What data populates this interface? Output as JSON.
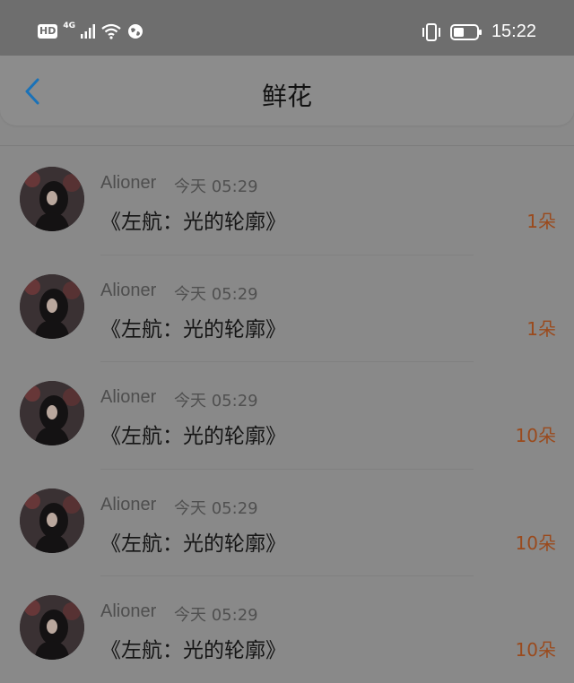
{
  "status_bar": {
    "hd_label": "HD",
    "network_label": "4G",
    "time": "15:22"
  },
  "header": {
    "title": "鲜花"
  },
  "items": [
    {
      "username": "Alioner",
      "time": "今天 05:29",
      "title": "《左航：光的轮廓》",
      "count": "1朵"
    },
    {
      "username": "Alioner",
      "time": "今天 05:29",
      "title": "《左航：光的轮廓》",
      "count": "1朵"
    },
    {
      "username": "Alioner",
      "time": "今天 05:29",
      "title": "《左航：光的轮廓》",
      "count": "10朵"
    },
    {
      "username": "Alioner",
      "time": "今天 05:29",
      "title": "《左航：光的轮廓》",
      "count": "10朵"
    },
    {
      "username": "Alioner",
      "time": "今天 05:29",
      "title": "《左航：光的轮廓》",
      "count": "10朵"
    }
  ],
  "colors": {
    "accent_back": "#1a72b8",
    "count_text": "#9a4a1d"
  }
}
